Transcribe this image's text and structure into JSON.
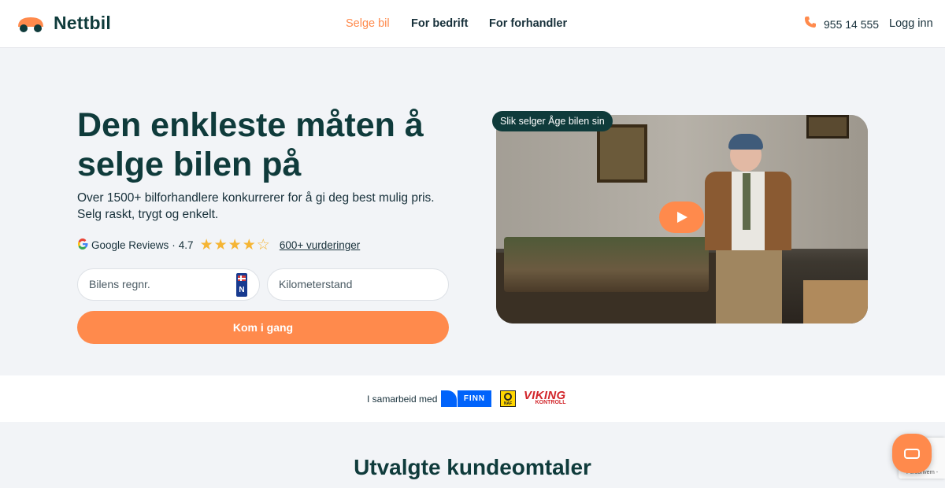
{
  "brand": {
    "name": "Nettbil",
    "accent": "#ff8a4c",
    "primary": "#0f3b3b"
  },
  "nav": {
    "items": [
      {
        "label": "Selge bil",
        "active": true
      },
      {
        "label": "For bedrift",
        "active": false
      },
      {
        "label": "For forhandler",
        "active": false
      }
    ],
    "phone": "955 14 555",
    "login": "Logg inn"
  },
  "hero": {
    "headline": "Den enkleste måten å selge bilen på",
    "subtext": "Over 1500+ bilforhandlere konkurrerer for å gi deg best mulig pris. Selg raskt, trygt og enkelt.",
    "reviews": {
      "source": "Google Reviews",
      "rating": "4.7",
      "rating_value": 4.7,
      "stars": 5,
      "link": "600+ vurderinger"
    },
    "form": {
      "regnr_placeholder": "Bilens regnr.",
      "plate_letter": "N",
      "km_placeholder": "Kilometerstand",
      "cta": "Kom i gang"
    },
    "video": {
      "badge": "Slik selger Åge bilen sin"
    }
  },
  "partners": {
    "label": "I samarbeid med",
    "logos": [
      {
        "name": "FINN",
        "text": "FINN"
      },
      {
        "name": "NAF",
        "text": "NAF"
      },
      {
        "name": "Viking Kontroll",
        "text": "VIKING",
        "subtext": "KONTROLL"
      }
    ]
  },
  "testimonials": {
    "title": "Utvalgte kundeomtaler"
  },
  "recaptcha": {
    "text": "Personvern -"
  }
}
